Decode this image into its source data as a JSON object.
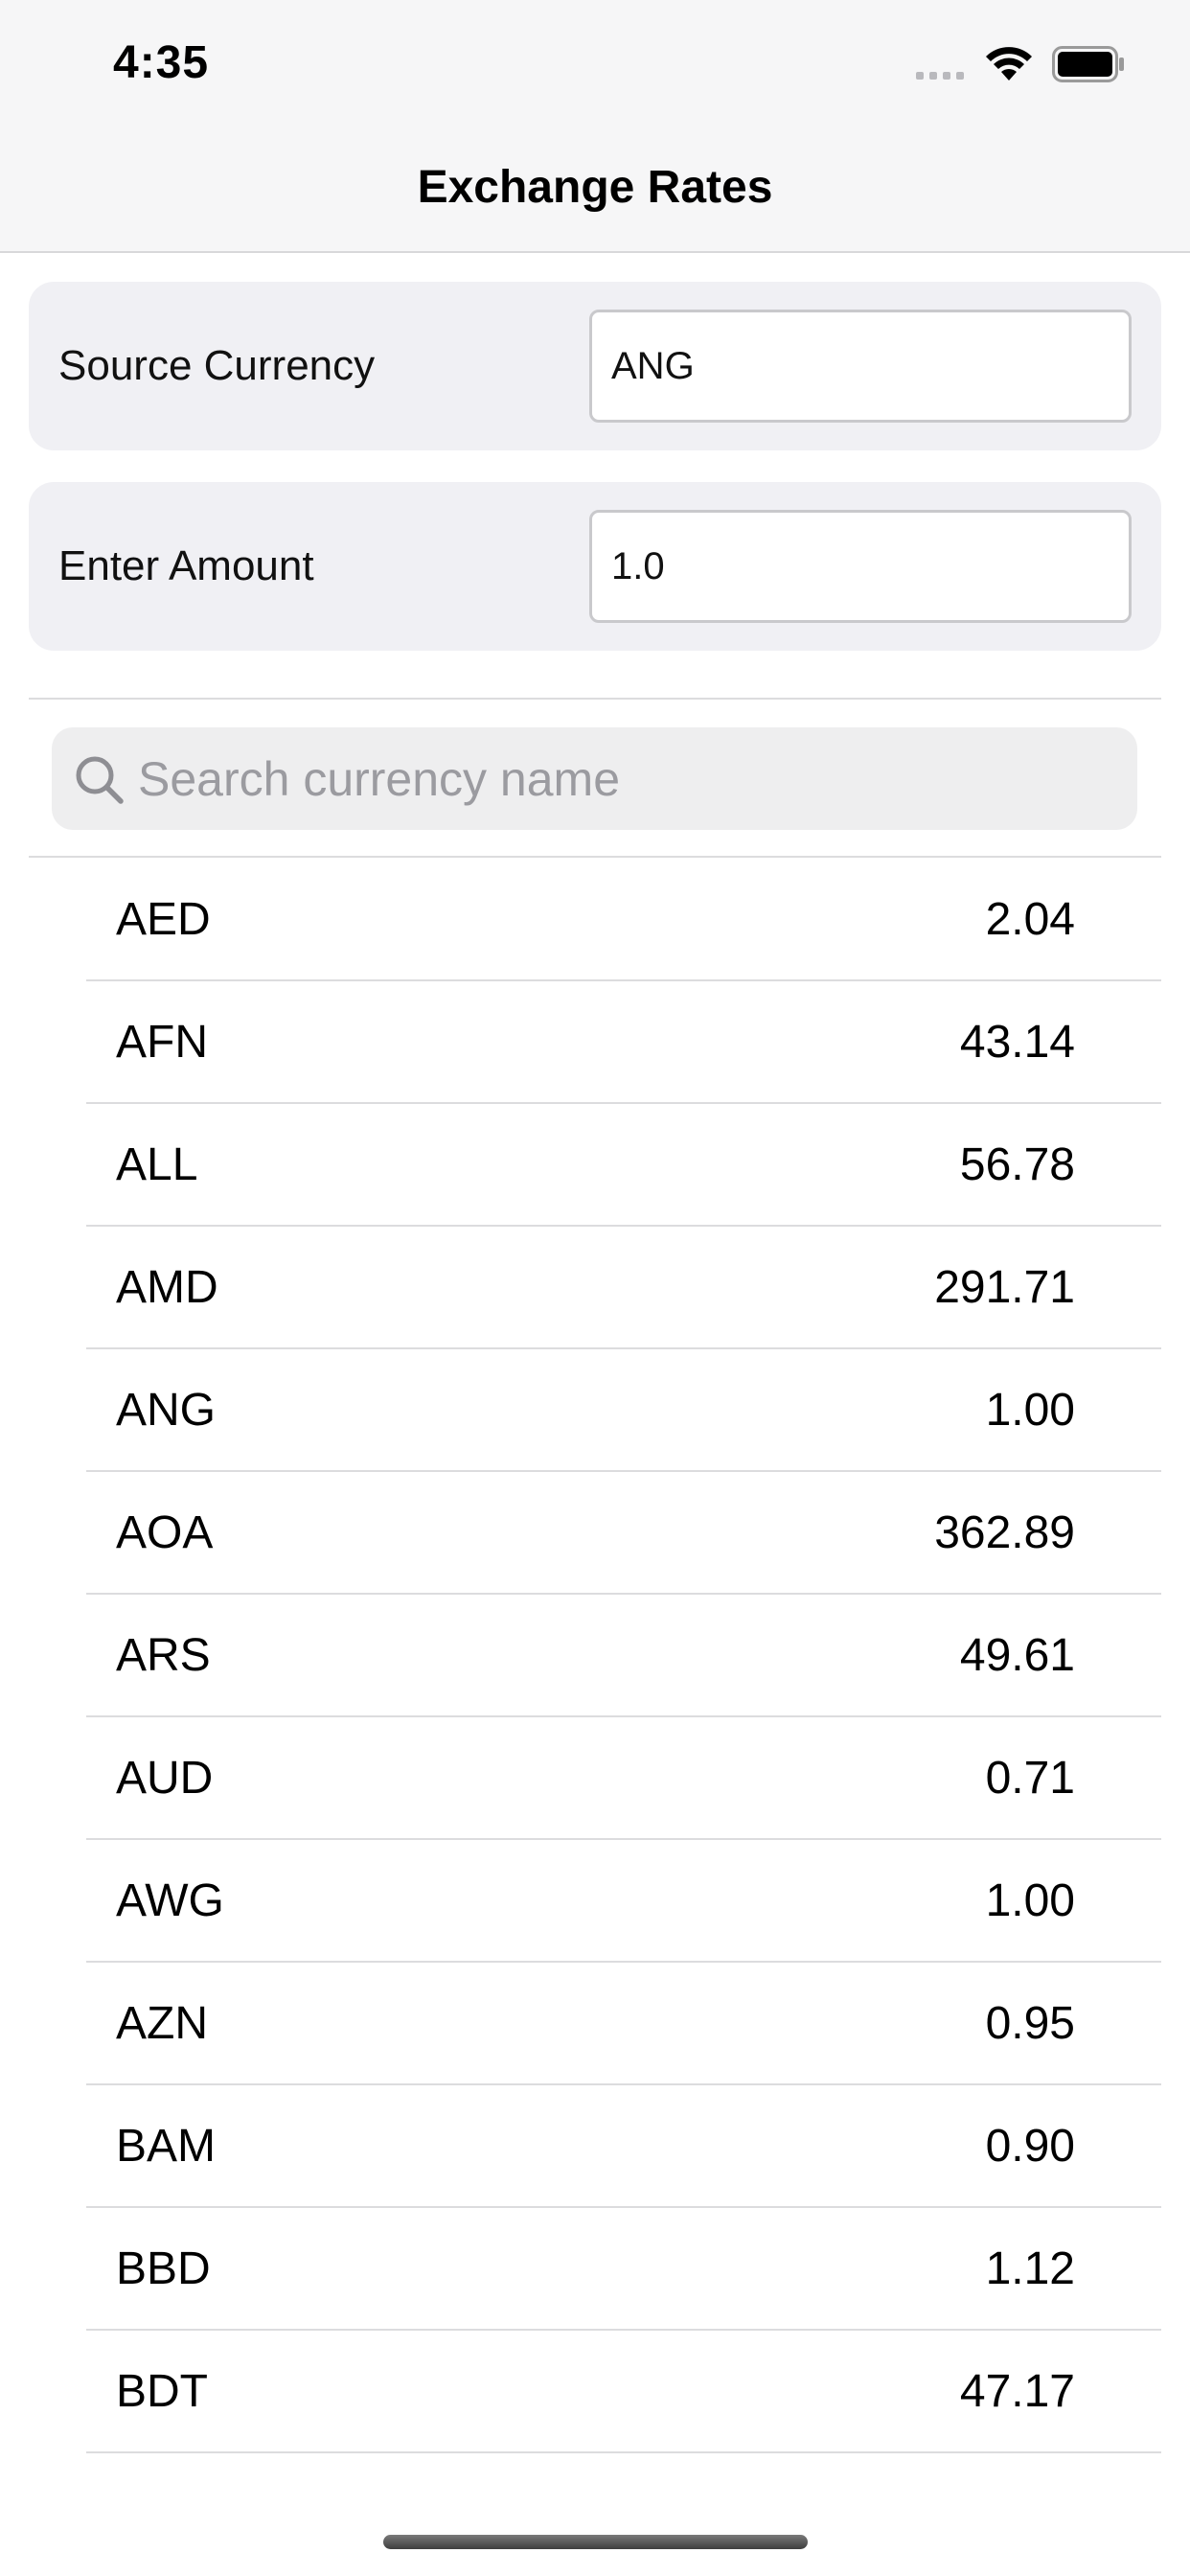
{
  "status_bar": {
    "time": "4:35"
  },
  "nav": {
    "title": "Exchange Rates"
  },
  "form": {
    "source_currency_label": "Source Currency",
    "source_currency_value": "ANG",
    "amount_label": "Enter Amount",
    "amount_value": "1.0"
  },
  "search": {
    "placeholder": "Search currency name",
    "value": ""
  },
  "rates": [
    {
      "code": "AED",
      "rate": "2.04"
    },
    {
      "code": "AFN",
      "rate": "43.14"
    },
    {
      "code": "ALL",
      "rate": "56.78"
    },
    {
      "code": "AMD",
      "rate": "291.71"
    },
    {
      "code": "ANG",
      "rate": "1.00"
    },
    {
      "code": "AOA",
      "rate": "362.89"
    },
    {
      "code": "ARS",
      "rate": "49.61"
    },
    {
      "code": "AUD",
      "rate": "0.71"
    },
    {
      "code": "AWG",
      "rate": "1.00"
    },
    {
      "code": "AZN",
      "rate": "0.95"
    },
    {
      "code": "BAM",
      "rate": "0.90"
    },
    {
      "code": "BBD",
      "rate": "1.12"
    },
    {
      "code": "BDT",
      "rate": "47.17"
    }
  ],
  "icons": {
    "signal": "cellular-signal-icon",
    "wifi": "wifi-icon",
    "battery": "battery-icon",
    "search": "search-icon"
  }
}
